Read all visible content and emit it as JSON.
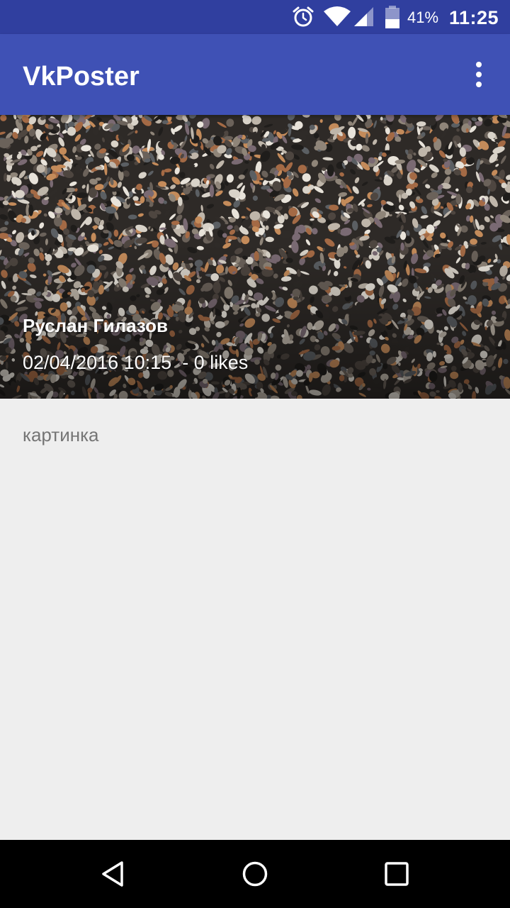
{
  "status_bar": {
    "icons": [
      "alarm-icon",
      "wifi-icon",
      "signal-icon",
      "battery-icon"
    ],
    "battery": "41%",
    "time": "11:25"
  },
  "app_bar": {
    "title": "VkPoster",
    "menu_icon": "more-vert-icon"
  },
  "post": {
    "author": "Руслан Гилазов",
    "meta": "02/04/2016 10:15  - 0 likes",
    "text": "картинка"
  },
  "nav_bar": {
    "icons": [
      "back-icon",
      "home-icon",
      "recents-icon"
    ]
  },
  "colors": {
    "status_bar": "#303f9f",
    "app_bar": "#3f51b5",
    "background": "#eeeeee",
    "nav_bar": "#000000"
  }
}
